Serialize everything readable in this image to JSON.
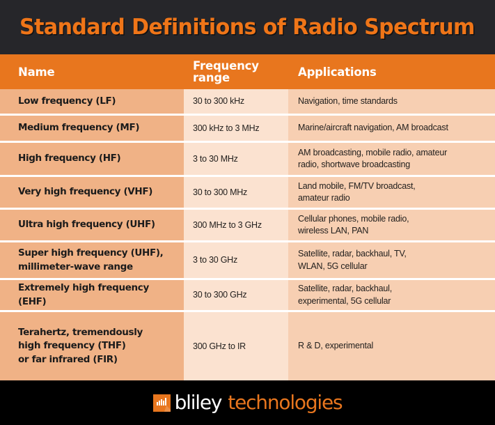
{
  "title": "Standard Definitions of Radio Spectrum",
  "colors": {
    "title_band_bg": "#26262a",
    "title_text": "#ef7518",
    "header_bg": "#e8761e",
    "header_text": "#ffffff",
    "name_cell_bg": "#f0b286",
    "freq_cell_bg": "#fbe2d0",
    "app_cell_bg": "#f7cfb2",
    "body_text": "#23201e",
    "footer_bg": "#000000",
    "accent": "#e8761e"
  },
  "table": {
    "columns": [
      "Name",
      "Frequency range",
      "Applications"
    ],
    "header": {
      "name": "Name",
      "frequency_line1": "Frequency",
      "frequency_line2": "range",
      "applications": "Applications"
    },
    "rows": [
      {
        "name": "Low frequency (LF)",
        "frequency": "30 to 300 kHz",
        "applications": "Navigation, time standards"
      },
      {
        "name": "Medium frequency (MF)",
        "frequency": "300 kHz to 3 MHz",
        "applications": "Marine/aircraft navigation, AM broadcast"
      },
      {
        "name": "High frequency (HF)",
        "frequency": "3 to 30 MHz",
        "applications_line1": "AM broadcasting, mobile radio, amateur",
        "applications_line2": "radio, shortwave broadcasting"
      },
      {
        "name": "Very high frequency (VHF)",
        "frequency": "30 to 300 MHz",
        "applications_line1": "Land mobile, FM/TV broadcast,",
        "applications_line2": "amateur radio"
      },
      {
        "name": "Ultra high frequency (UHF)",
        "frequency": "300 MHz to 3 GHz",
        "applications_line1": "Cellular phones, mobile radio,",
        "applications_line2": "wireless LAN, PAN"
      },
      {
        "name_line1": "Super high frequency (UHF),",
        "name_line2": "millimeter-wave range",
        "frequency": "3 to 30 GHz",
        "applications_line1": "Satellite, radar, backhaul, TV,",
        "applications_line2": "WLAN, 5G cellular"
      },
      {
        "name": "Extremely high frequency (EHF)",
        "frequency": "30 to 300 GHz",
        "applications_line1": "Satellite, radar, backhaul,",
        "applications_line2": "experimental, 5G cellular"
      },
      {
        "name_line1": "Terahertz, tremendously",
        "name_line2": "high frequency (THF)",
        "name_line3": "or far infrared (FIR)",
        "frequency": "300 GHz to IR",
        "applications": "R & D, experimental"
      }
    ]
  },
  "footer": {
    "logo_icon": "equalizer-bars-icon",
    "brand_primary": "bliley",
    "brand_secondary": "technologies"
  }
}
